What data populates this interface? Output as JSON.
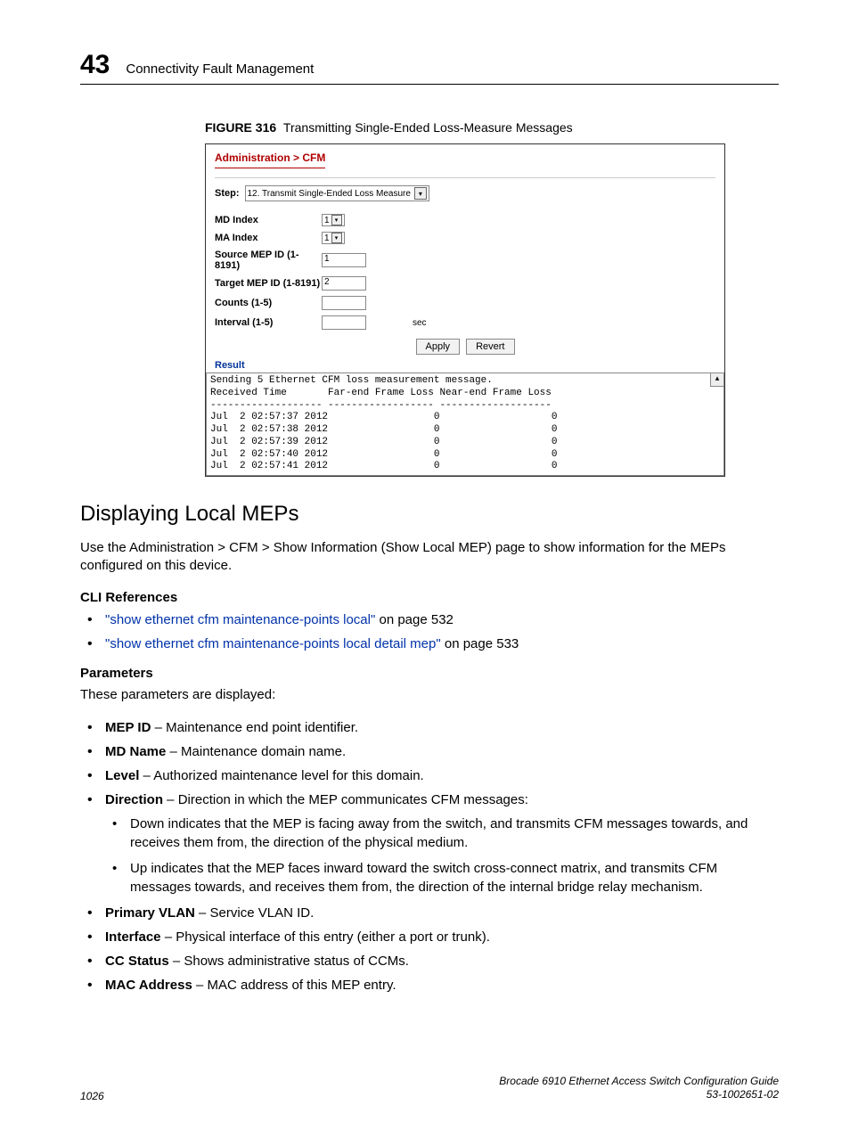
{
  "header": {
    "chapter_number": "43",
    "chapter_title": "Connectivity Fault Management"
  },
  "figure": {
    "label_prefix": "FIGURE 316",
    "caption": "Transmitting Single-Ended Loss-Measure Messages",
    "breadcrumb": "Administration > CFM",
    "step_label": "Step:",
    "step_value": "12. Transmit Single-Ended Loss Measure",
    "fields": {
      "md_index_label": "MD Index",
      "md_index_value": "1",
      "ma_index_label": "MA Index",
      "ma_index_value": "1",
      "source_mep_label": "Source MEP ID (1-8191)",
      "source_mep_value": "1",
      "target_mep_label": "Target MEP ID (1-8191)",
      "target_mep_value": "2",
      "counts_label": "Counts (1-5)",
      "counts_value": "",
      "interval_label": "Interval (1-5)",
      "interval_value": "",
      "interval_unit": "sec"
    },
    "buttons": {
      "apply": "Apply",
      "revert": "Revert"
    },
    "result_label": "Result",
    "result_text": "Sending 5 Ethernet CFM loss measurement message.\nReceived Time       Far-end Frame Loss Near-end Frame Loss\n------------------- ------------------ -------------------\nJul  2 02:57:37 2012                  0                   0\nJul  2 02:57:38 2012                  0                   0\nJul  2 02:57:39 2012                  0                   0\nJul  2 02:57:40 2012                  0                   0\nJul  2 02:57:41 2012                  0                   0",
    "scroll_glyph": "▴"
  },
  "section": {
    "heading": "Displaying Local MEPs",
    "intro": "Use the Administration > CFM > Show Information (Show Local MEP) page to show information for the MEPs configured on this device.",
    "cli_heading": "CLI References",
    "cli_refs": [
      {
        "link": "\"show ethernet cfm maintenance-points local\"",
        "tail": " on page 532"
      },
      {
        "link": "\"show ethernet cfm maintenance-points local detail mep\"",
        "tail": " on page 533"
      }
    ],
    "params_heading": "Parameters",
    "params_intro": "These parameters are displayed:",
    "params": [
      {
        "term": "MEP ID",
        "desc": " – Maintenance end point identifier."
      },
      {
        "term": "MD Name",
        "desc": " – Maintenance domain name."
      },
      {
        "term": "Level",
        "desc": " – Authorized maintenance level for this domain."
      },
      {
        "term": "Direction",
        "desc": " – Direction in which the MEP communicates CFM messages:",
        "sub": [
          "Down indicates that the MEP is facing away from the switch, and transmits CFM messages towards, and receives them from, the direction of the physical medium.",
          "Up indicates that the MEP faces inward toward the switch cross-connect matrix, and transmits CFM messages towards, and receives them from, the direction of the internal bridge relay mechanism."
        ]
      },
      {
        "term": "Primary VLAN",
        "desc": " – Service VLAN ID."
      },
      {
        "term": "Interface",
        "desc": " – Physical interface of this entry (either a port or trunk)."
      },
      {
        "term": "CC Status",
        "desc": " – Shows administrative status of CCMs."
      },
      {
        "term": "MAC Address",
        "desc": " – MAC address of this MEP entry."
      }
    ]
  },
  "footer": {
    "page": "1026",
    "doc_title": "Brocade 6910 Ethernet Access Switch Configuration Guide",
    "doc_num": "53-1002651-02"
  }
}
